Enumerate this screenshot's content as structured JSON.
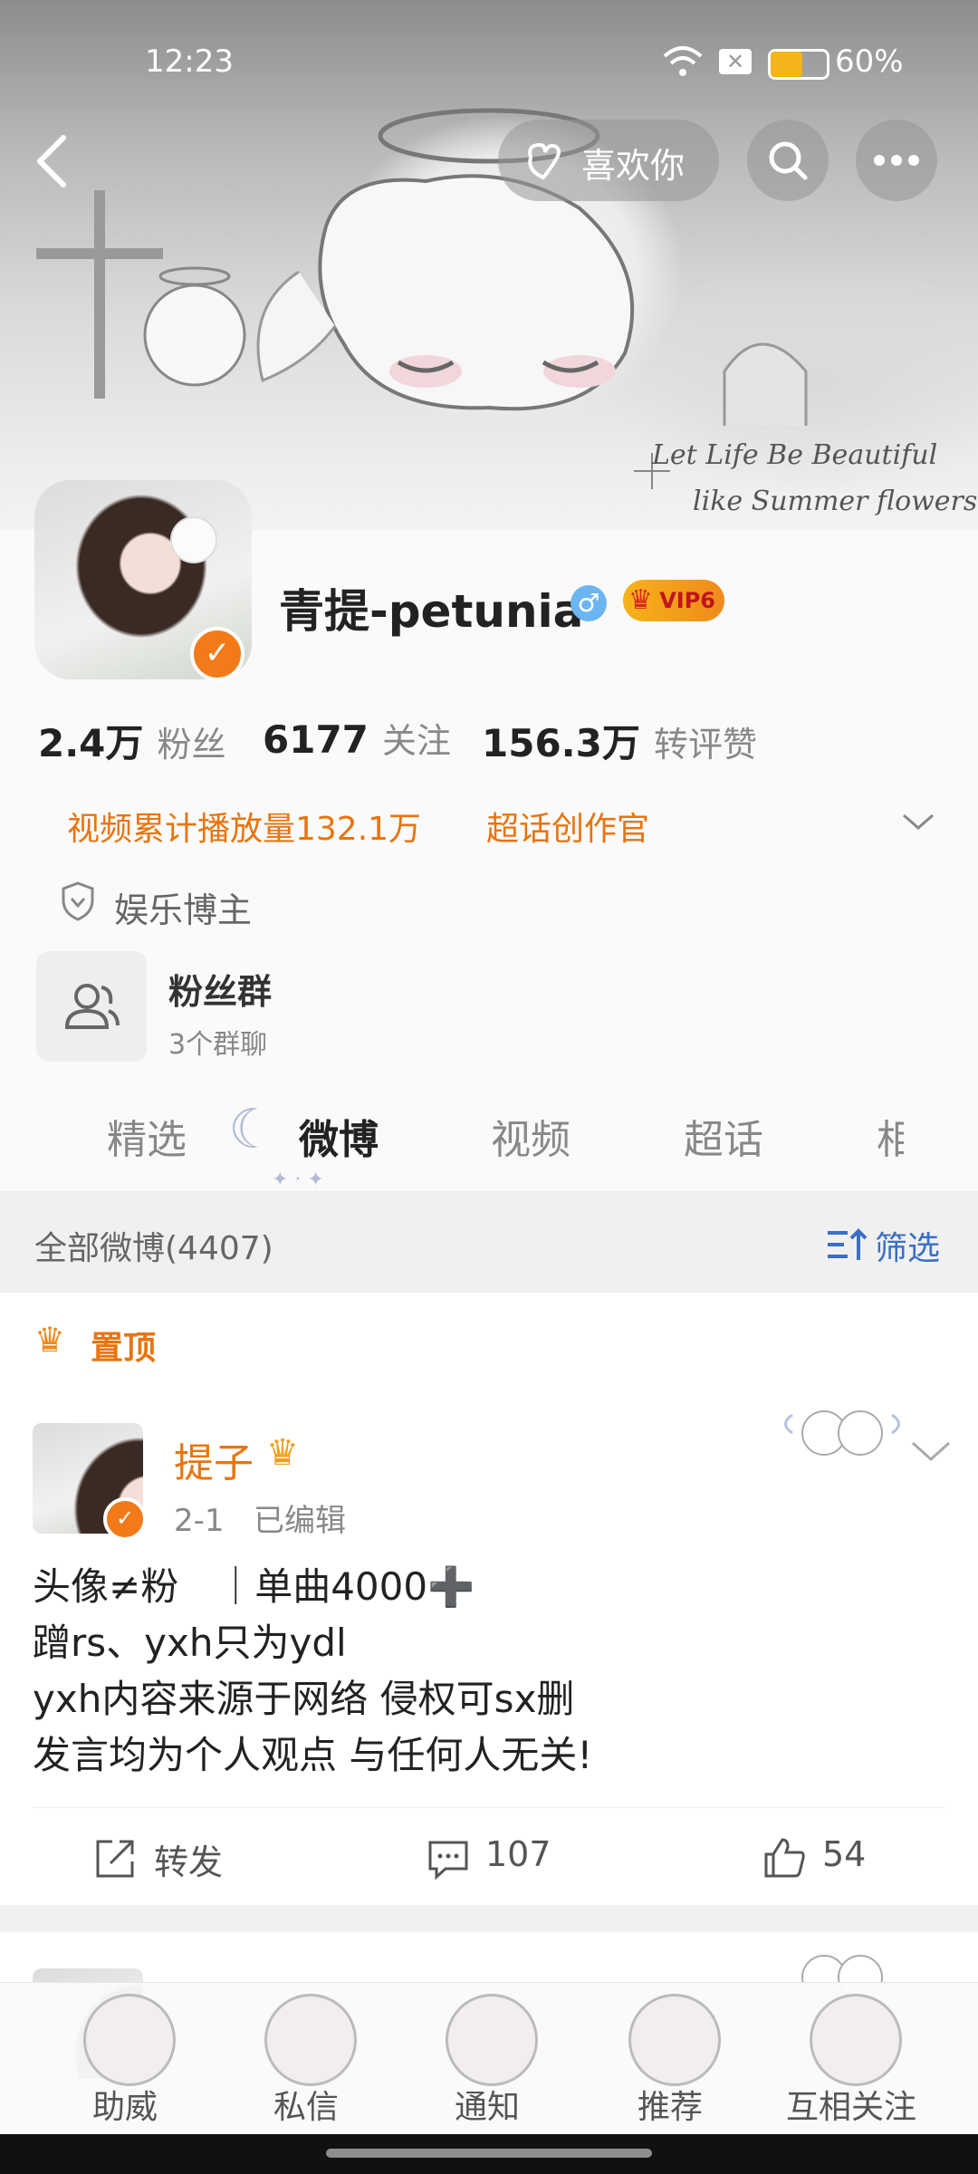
{
  "status_bar": {
    "time": "12:23",
    "battery": "60%"
  },
  "header": {
    "like_label": "喜欢你"
  },
  "banner_text": [
    "Let Life Be Beautiful",
    "like Summer flowers",
    "life"
  ],
  "profile": {
    "name": "青提-petunia",
    "vip": "VIP6",
    "stats": [
      {
        "num": "2.4万",
        "label": "粉丝"
      },
      {
        "num": "6177",
        "label": "关注"
      },
      {
        "num": "156.3万",
        "label": "转评赞"
      }
    ],
    "tags": [
      "视频累计播放量132.1万",
      "超话创作官"
    ],
    "category": "娱乐博主",
    "fan_group": {
      "title": "粉丝群",
      "subtitle": "3个群聊"
    }
  },
  "tabs": [
    "精选",
    "微博",
    "视频",
    "超话",
    "相"
  ],
  "feed": {
    "all_label": "全部微博(4407)",
    "filter_label": "筛选",
    "pinned_label": "置顶",
    "post": {
      "author": "提子",
      "meta": "2-1   已编辑",
      "lines": [
        "头像≠粉　｜单曲4000➕",
        "蹭rs、yxh只为ydl",
        "yxh内容来源于网络 侵权可sx删",
        "发言均为个人观点 与任何人无关!"
      ],
      "repost_label": "转发",
      "comments": "107",
      "likes": "54"
    }
  },
  "bottom_nav": [
    "助威",
    "私信",
    "通知",
    "推荐",
    "互相关注"
  ],
  "colors": {
    "accent": "#e8740f",
    "link_blue": "#3a6fc4"
  }
}
